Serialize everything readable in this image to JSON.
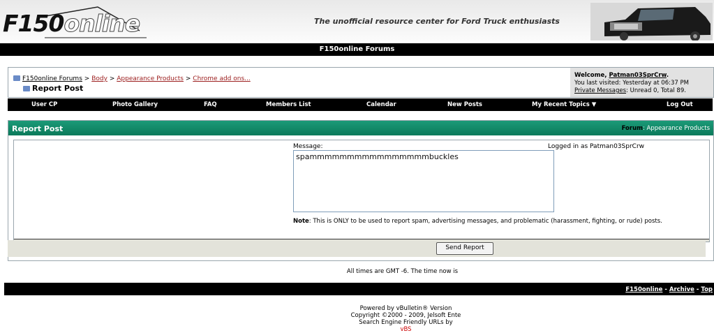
{
  "header": {
    "logo_main": "F150",
    "logo_sub": "online",
    "tagline_pre": "The ",
    "tagline_bold": "unofficial",
    "tagline_post": " resource center for Ford Truck enthusiasts"
  },
  "topbar": {
    "title": "F150online Forums"
  },
  "breadcrumb": {
    "home": "F150online Forums",
    "sep": ">",
    "items": [
      "Body",
      "Appearance Products",
      "Chrome add ons..."
    ],
    "current": "Report Post"
  },
  "welcome": {
    "greeting": "Welcome, ",
    "user": "Patman03SprCrw",
    "greeting_end": ".",
    "last_visit": "You last visited: Yesterday at 06:37 PM",
    "pm_link": "Private Messages",
    "pm_status": ": Unread 0, Total 89."
  },
  "nav": {
    "items": [
      "User CP",
      "Photo Gallery",
      "FAQ",
      "Members List",
      "Calendar",
      "New Posts",
      "My Recent Topics ▼",
      "Log Out"
    ]
  },
  "panel": {
    "title": "Report Post",
    "forum_label": "Forum",
    "forum_name": ": Appearance Products",
    "message_label": "Message:",
    "logged_in": "Logged in as Patman03SprCrw",
    "message_value": "spammmmmmmmmmmmmmmmbuckles",
    "note_label": "Note",
    "note_text": ": This is ONLY to be used to report spam, advertising messages, and problematic (harassment, fighting, or rude) posts.",
    "send_label": "Send Report"
  },
  "times": "All times are GMT -6. The time now is",
  "footer": {
    "link1": "F150online",
    "link2": "Archive",
    "link3": "Top",
    "dash": " - "
  },
  "powered": {
    "line1": "Powered by vBulletin® Version",
    "line2": "Copyright ©2000 - 2009, Jelsoft Ente",
    "line3_pre": "Search Engine Friendly URLs by ",
    "line3_red": "vBS"
  },
  "colors": {
    "panel_header": "#0b7a5a",
    "link_red": "#9b1c1c"
  }
}
